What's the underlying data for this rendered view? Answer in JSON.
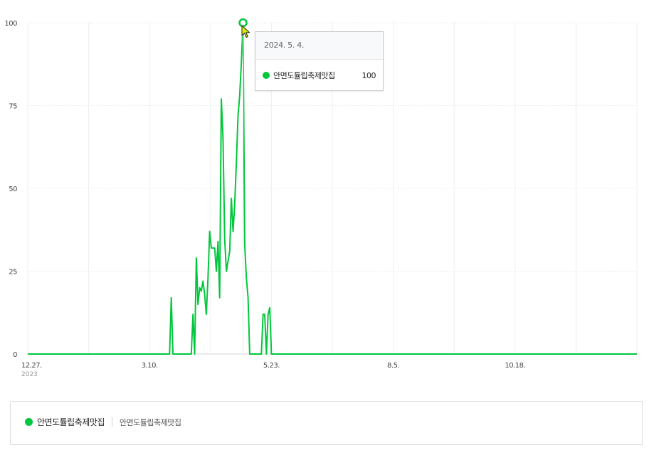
{
  "chart_data": {
    "type": "line",
    "y_ticks": [
      0,
      25,
      50,
      75,
      100
    ],
    "ylim": [
      0,
      100
    ],
    "x_tick_labels": [
      {
        "label": "12.27.",
        "sub": "2023"
      },
      {
        "label": "3.10.",
        "sub": ""
      },
      {
        "label": "5.23.",
        "sub": ""
      },
      {
        "label": "8.5.",
        "sub": ""
      },
      {
        "label": "10.18.",
        "sub": ""
      }
    ],
    "xlim": [
      "2023-12-27",
      "2024-12-26"
    ],
    "grid": true,
    "series": [
      {
        "name": "안면도튤립축제맛집",
        "color": "#00c73c",
        "points": [
          [
            "2023-12-27",
            0
          ],
          [
            "2024-03-21",
            0
          ],
          [
            "2024-03-22",
            17
          ],
          [
            "2024-03-23",
            0
          ],
          [
            "2024-04-03",
            0
          ],
          [
            "2024-04-04",
            12
          ],
          [
            "2024-04-05",
            0
          ],
          [
            "2024-04-06",
            29
          ],
          [
            "2024-04-07",
            15
          ],
          [
            "2024-04-08",
            20
          ],
          [
            "2024-04-09",
            19
          ],
          [
            "2024-04-10",
            22
          ],
          [
            "2024-04-11",
            18
          ],
          [
            "2024-04-12",
            12
          ],
          [
            "2024-04-13",
            23
          ],
          [
            "2024-04-14",
            37
          ],
          [
            "2024-04-15",
            32
          ],
          [
            "2024-04-16",
            32
          ],
          [
            "2024-04-17",
            32
          ],
          [
            "2024-04-18",
            25
          ],
          [
            "2024-04-19",
            34
          ],
          [
            "2024-04-20",
            17
          ],
          [
            "2024-04-21",
            77
          ],
          [
            "2024-04-22",
            65
          ],
          [
            "2024-04-23",
            35
          ],
          [
            "2024-04-24",
            25
          ],
          [
            "2024-04-25",
            28
          ],
          [
            "2024-04-26",
            31
          ],
          [
            "2024-04-27",
            47
          ],
          [
            "2024-04-28",
            37
          ],
          [
            "2024-04-29",
            45
          ],
          [
            "2024-04-30",
            58
          ],
          [
            "2024-05-01",
            72
          ],
          [
            "2024-05-02",
            78
          ],
          [
            "2024-05-03",
            88
          ],
          [
            "2024-05-04",
            100
          ],
          [
            "2024-05-05",
            33
          ],
          [
            "2024-05-06",
            23
          ],
          [
            "2024-05-07",
            17
          ],
          [
            "2024-05-08",
            0
          ],
          [
            "2024-05-15",
            0
          ],
          [
            "2024-05-16",
            12
          ],
          [
            "2024-05-17",
            12
          ],
          [
            "2024-05-18",
            0
          ],
          [
            "2024-05-19",
            12
          ],
          [
            "2024-05-20",
            14
          ],
          [
            "2024-05-21",
            0
          ],
          [
            "2024-12-26",
            0
          ]
        ]
      }
    ],
    "highlight": {
      "date": "2024-05-04",
      "value": 100
    }
  },
  "tooltip": {
    "date": "2024. 5. 4.",
    "series_name": "안면도튤립축제맛집",
    "value": "100"
  },
  "legend": {
    "series_name": "안면도튤립축제맛집",
    "keywords": "안면도튤립축제맛집",
    "color": "#00c73c"
  }
}
